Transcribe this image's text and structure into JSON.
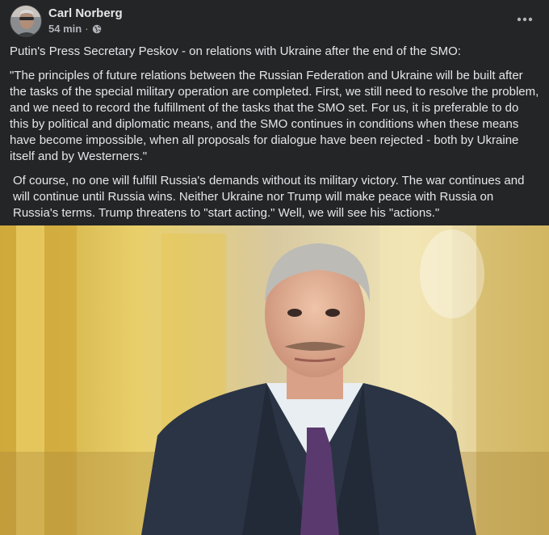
{
  "post": {
    "author": "Carl Norberg",
    "time": "54 min",
    "separator": "·",
    "privacy_icon": "globe-icon",
    "more_icon": "more-horizontal-icon",
    "paragraphs": [
      "Putin's Press Secretary Peskov - on relations with Ukraine after the end of the SMO:",
      "\"The principles of future relations between the Russian Federation and Ukraine will be built after the tasks of the special military operation are completed. First, we still need to resolve the problem, and we need to record the fulfillment of the tasks that the SMO set. For us, it is preferable to do this by political and diplomatic means, and the SMO continues in conditions when these means have become impossible, when all proposals for dialogue have been rejected - both by Ukraine itself and by Westerners.\"",
      "Of course, no one will fulfill Russia's demands without its military victory. The war continues and will continue until Russia wins. Neither Ukraine nor Trump will make peace with Russia on Russia's terms. Trump threatens to \"start acting.\" Well, we will see his \"actions.\""
    ]
  },
  "colors": {
    "background": "#242526",
    "primary_text": "#e4e6eb",
    "secondary_text": "#b0b3b8"
  }
}
